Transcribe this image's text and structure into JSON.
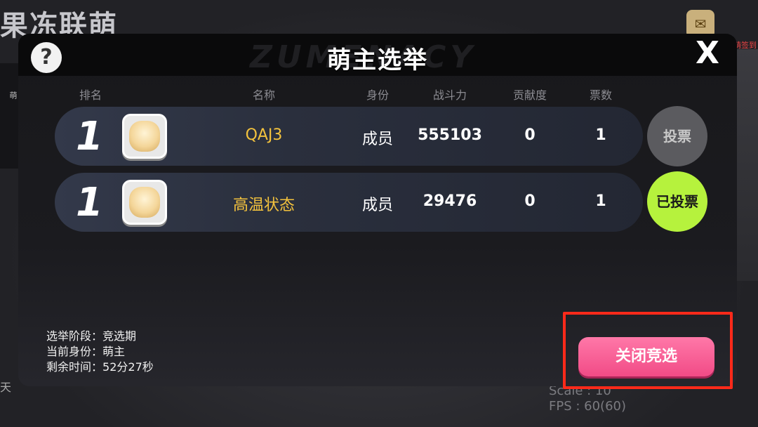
{
  "background": {
    "title": "果冻联萌",
    "left_text": "萌",
    "left_text2": "天",
    "topright_label": "萌签到",
    "debug_line1": "Scale : 10",
    "debug_line2": "FPS : 60(60)"
  },
  "dialog": {
    "title": "萌主选举",
    "deco_text": "ZUMENACY",
    "help_label": "?",
    "close_label": "X",
    "columns": [
      "排名",
      "名称",
      "身份",
      "战斗力",
      "贡献度",
      "票数"
    ],
    "rows": [
      {
        "rank": "1",
        "name": "QAJ3",
        "role": "成员",
        "power": "555103",
        "contribution": "0",
        "votes": "1",
        "vote_button": "投票",
        "voted": false
      },
      {
        "rank": "1",
        "name": "高温状态",
        "role": "成员",
        "power": "29476",
        "contribution": "0",
        "votes": "1",
        "vote_button": "已投票",
        "voted": true
      }
    ],
    "info": {
      "stage_label": "选举阶段",
      "stage_value": "竞选期",
      "identity_label": "当前身份",
      "identity_value": "萌主",
      "remaining_label": "剩余时间",
      "remaining_value": "52分27秒",
      "separator": "："
    },
    "close_election_label": "关闭竞选"
  },
  "colors": {
    "name_gold": "#f3c23d",
    "voted_green": "#b6f23d",
    "close_election_pink": "#f14b86",
    "highlight_red": "#ff2a1a"
  }
}
